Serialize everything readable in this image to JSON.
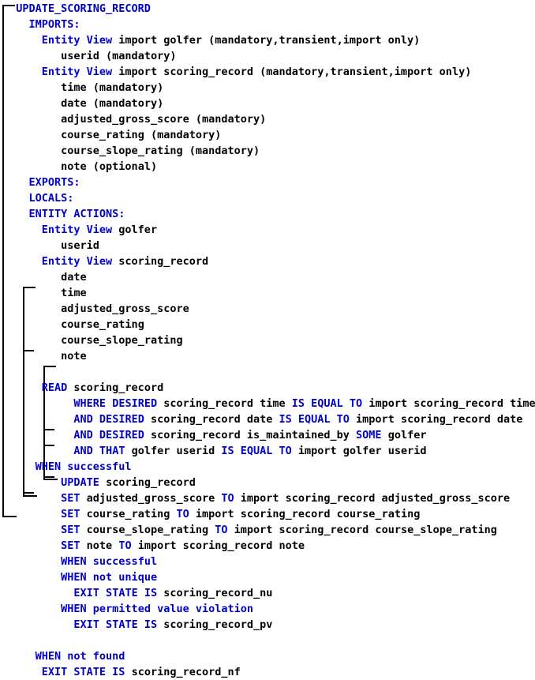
{
  "diagram": {
    "title": "UPDATE_SCORING_RECORD",
    "type": "action-diagram",
    "colors": {
      "keyword": "#0000CC",
      "identifier": "#000000",
      "background": "#FFFFFF",
      "bracket": "#000000"
    },
    "lines": [
      {
        "id": "l01",
        "indent": 2,
        "text": "UPDATE_SCORING_RECORD",
        "kw": "UPDATE_SCORING_RECORD",
        "rest": ""
      },
      {
        "id": "l02",
        "indent": 4,
        "text": "IMPORTS:",
        "kw": "IMPORTS:",
        "rest": ""
      },
      {
        "id": "l03",
        "indent": 6,
        "text": "Entity View import golfer (mandatory,transient,import only)",
        "kw": "Entity View",
        "rest": " import golfer (mandatory,transient,import only)"
      },
      {
        "id": "l04",
        "indent": 9,
        "text": "userid (mandatory)",
        "kw": "",
        "rest": "userid (mandatory)"
      },
      {
        "id": "l05",
        "indent": 6,
        "text": "Entity View import scoring_record (mandatory,transient,import only)",
        "kw": "Entity View",
        "rest": " import scoring_record (mandatory,transient,import only)"
      },
      {
        "id": "l06",
        "indent": 9,
        "text": "time (mandatory)",
        "kw": "",
        "rest": "time (mandatory)"
      },
      {
        "id": "l07",
        "indent": 9,
        "text": "date (mandatory)",
        "kw": "",
        "rest": "date (mandatory)"
      },
      {
        "id": "l08",
        "indent": 9,
        "text": "adjusted_gross_score (mandatory)",
        "kw": "",
        "rest": "adjusted_gross_score (mandatory)"
      },
      {
        "id": "l09",
        "indent": 9,
        "text": "course_rating (mandatory)",
        "kw": "",
        "rest": "course_rating (mandatory)"
      },
      {
        "id": "l10",
        "indent": 9,
        "text": "course_slope_rating (mandatory)",
        "kw": "",
        "rest": "course_slope_rating (mandatory)"
      },
      {
        "id": "l11",
        "indent": 9,
        "text": "note (optional)",
        "kw": "",
        "rest": "note (optional)"
      },
      {
        "id": "l12",
        "indent": 4,
        "text": "EXPORTS:",
        "kw": "EXPORTS:",
        "rest": ""
      },
      {
        "id": "l13",
        "indent": 4,
        "text": "LOCALS:",
        "kw": "LOCALS:",
        "rest": ""
      },
      {
        "id": "l14",
        "indent": 4,
        "text": "ENTITY ACTIONS:",
        "kw": "ENTITY ACTIONS:",
        "rest": ""
      },
      {
        "id": "l15",
        "indent": 6,
        "text": "Entity View golfer",
        "kw": "Entity View",
        "rest": " golfer"
      },
      {
        "id": "l16",
        "indent": 9,
        "text": "userid",
        "kw": "",
        "rest": "userid"
      },
      {
        "id": "l17",
        "indent": 6,
        "text": "Entity View scoring_record",
        "kw": "Entity View",
        "rest": " scoring_record"
      },
      {
        "id": "l18",
        "indent": 9,
        "text": "date",
        "kw": "",
        "rest": "date"
      },
      {
        "id": "l19",
        "indent": 9,
        "text": "time",
        "kw": "",
        "rest": "time"
      },
      {
        "id": "l20",
        "indent": 9,
        "text": "adjusted_gross_score",
        "kw": "",
        "rest": "adjusted_gross_score"
      },
      {
        "id": "l21",
        "indent": 9,
        "text": "course_rating",
        "kw": "",
        "rest": "course_rating"
      },
      {
        "id": "l22",
        "indent": 9,
        "text": "course_slope_rating",
        "kw": "",
        "rest": "course_slope_rating"
      },
      {
        "id": "l23",
        "indent": 9,
        "text": "note",
        "kw": "",
        "rest": "note"
      },
      {
        "id": "l24",
        "indent": 0,
        "text": "",
        "kw": "",
        "rest": ""
      },
      {
        "id": "l25",
        "indent": 6,
        "text": "READ scoring_record",
        "kw": "READ",
        "rest": " scoring_record"
      },
      {
        "id": "l26",
        "indent": 11,
        "text": "WHERE DESIRED scoring_record time IS EQUAL TO import scoring_record time",
        "kw": "WHERE DESIRED",
        "rest": " scoring_record time ",
        "kw2": "IS EQUAL TO",
        "rest2": " import scoring_record time"
      },
      {
        "id": "l27",
        "indent": 11,
        "text": "AND DESIRED scoring_record date IS EQUAL TO import scoring_record date",
        "kw": "AND DESIRED",
        "rest": " scoring_record date ",
        "kw2": "IS EQUAL TO",
        "rest2": " import scoring_record date"
      },
      {
        "id": "l28",
        "indent": 11,
        "text": "AND DESIRED scoring_record is_maintained_by SOME golfer",
        "kw": "AND DESIRED",
        "rest": " scoring_record is_maintained_by ",
        "kw2": "SOME",
        "rest2": " golfer"
      },
      {
        "id": "l29",
        "indent": 11,
        "text": "AND THAT golfer userid IS EQUAL TO import golfer userid",
        "kw": "AND THAT",
        "rest": " golfer userid ",
        "kw2": "IS EQUAL TO",
        "rest2": " import golfer userid"
      },
      {
        "id": "l30",
        "indent": 5,
        "text": "WHEN successful",
        "kw": "WHEN successful",
        "rest": ""
      },
      {
        "id": "l31",
        "indent": 9,
        "text": "UPDATE scoring_record",
        "kw": "UPDATE",
        "rest": " scoring_record"
      },
      {
        "id": "l32",
        "indent": 9,
        "text": "SET adjusted_gross_score TO import scoring_record adjusted_gross_score",
        "kw": "SET",
        "rest": " adjusted_gross_score ",
        "kw2": "TO",
        "rest2": " import scoring_record adjusted_gross_score"
      },
      {
        "id": "l33",
        "indent": 9,
        "text": "SET course_rating TO import scoring_record course_rating",
        "kw": "SET",
        "rest": " course_rating ",
        "kw2": "TO",
        "rest2": " import scoring_record course_rating"
      },
      {
        "id": "l34",
        "indent": 9,
        "text": "SET course_slope_rating TO import scoring_record course_slope_rating",
        "kw": "SET",
        "rest": " course_slope_rating ",
        "kw2": "TO",
        "rest2": " import scoring_record course_slope_rating"
      },
      {
        "id": "l35",
        "indent": 9,
        "text": "SET note TO import scoring_record note",
        "kw": "SET",
        "rest": " note ",
        "kw2": "TO",
        "rest2": " import scoring_record note"
      },
      {
        "id": "l36",
        "indent": 9,
        "text": "WHEN successful",
        "kw": "WHEN successful",
        "rest": ""
      },
      {
        "id": "l37",
        "indent": 9,
        "text": "WHEN not unique",
        "kw": "WHEN not unique",
        "rest": ""
      },
      {
        "id": "l38",
        "indent": 11,
        "text": "EXIT STATE IS scoring_record_nu",
        "kw": "EXIT STATE IS",
        "rest": " scoring_record_nu"
      },
      {
        "id": "l39",
        "indent": 9,
        "text": "WHEN permitted value violation",
        "kw": "WHEN permitted value violation",
        "rest": ""
      },
      {
        "id": "l40",
        "indent": 11,
        "text": "EXIT STATE IS scoring_record_pv",
        "kw": "EXIT STATE IS",
        "rest": " scoring_record_pv"
      },
      {
        "id": "l41",
        "indent": 0,
        "text": "",
        "kw": "",
        "rest": ""
      },
      {
        "id": "l42",
        "indent": 5,
        "text": "WHEN not found",
        "kw": "WHEN not found",
        "rest": ""
      },
      {
        "id": "l43",
        "indent": 6,
        "text": "EXIT STATE IS scoring_record_nf",
        "kw": "EXIT STATE IS",
        "rest": " scoring_record_nf"
      }
    ],
    "brackets": [
      {
        "id": "b-outer",
        "name": "procedure-bracket"
      },
      {
        "id": "b-read",
        "name": "read-block-bracket"
      },
      {
        "id": "b-update",
        "name": "update-block-bracket"
      }
    ]
  }
}
